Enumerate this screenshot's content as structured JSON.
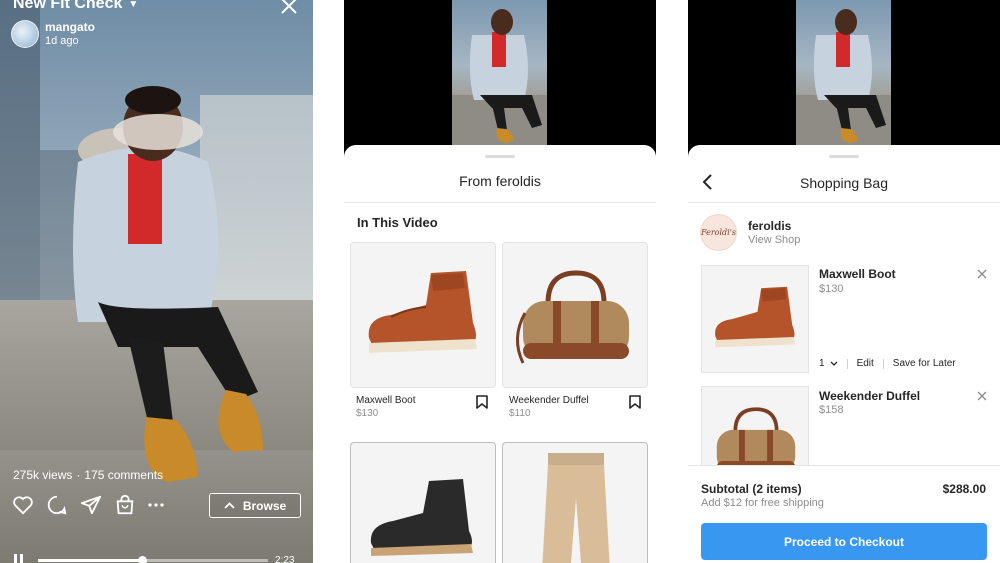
{
  "video": {
    "title": "New Fit Check",
    "username": "mangato",
    "posted_ago": "1d ago",
    "views": "275k views",
    "stats_separator": "·",
    "comments": "175 comments",
    "browse_label": "Browse",
    "duration": "2:23",
    "progress_fraction": 0.45
  },
  "catalog": {
    "shop_title": "From feroldis",
    "section_title": "In This Video",
    "products": [
      {
        "name": "Maxwell Boot",
        "price": "$130"
      },
      {
        "name": "Weekender Duffel",
        "price": "$110"
      }
    ]
  },
  "bag": {
    "title": "Shopping Bag",
    "shop_name": "feroldis",
    "shop_logo_text": "Feroldi's",
    "view_shop": "View Shop",
    "items": [
      {
        "name": "Maxwell Boot",
        "price": "$130",
        "qty": "1",
        "edit": "Edit",
        "save_later": "Save for Later"
      },
      {
        "name": "Weekender Duffel",
        "price": "$158"
      }
    ],
    "subtotal_label": "Subtotal (2 items)",
    "subtotal_value": "$288.00",
    "shipping_note": "Add $12 for free shipping",
    "checkout_label": "Proceed to Checkout"
  },
  "colors": {
    "accent": "#3897f0",
    "boot": "#b5532a",
    "duffel": "#b08a5c",
    "text": "#262626",
    "muted": "#8e8e8e"
  },
  "icons": [
    "chevron-down-icon",
    "close-icon",
    "heart-icon",
    "comment-icon",
    "share-icon",
    "shopping-bag-icon",
    "more-icon",
    "chevron-up-icon",
    "pause-icon",
    "bookmark-icon",
    "back-icon",
    "remove-icon"
  ]
}
